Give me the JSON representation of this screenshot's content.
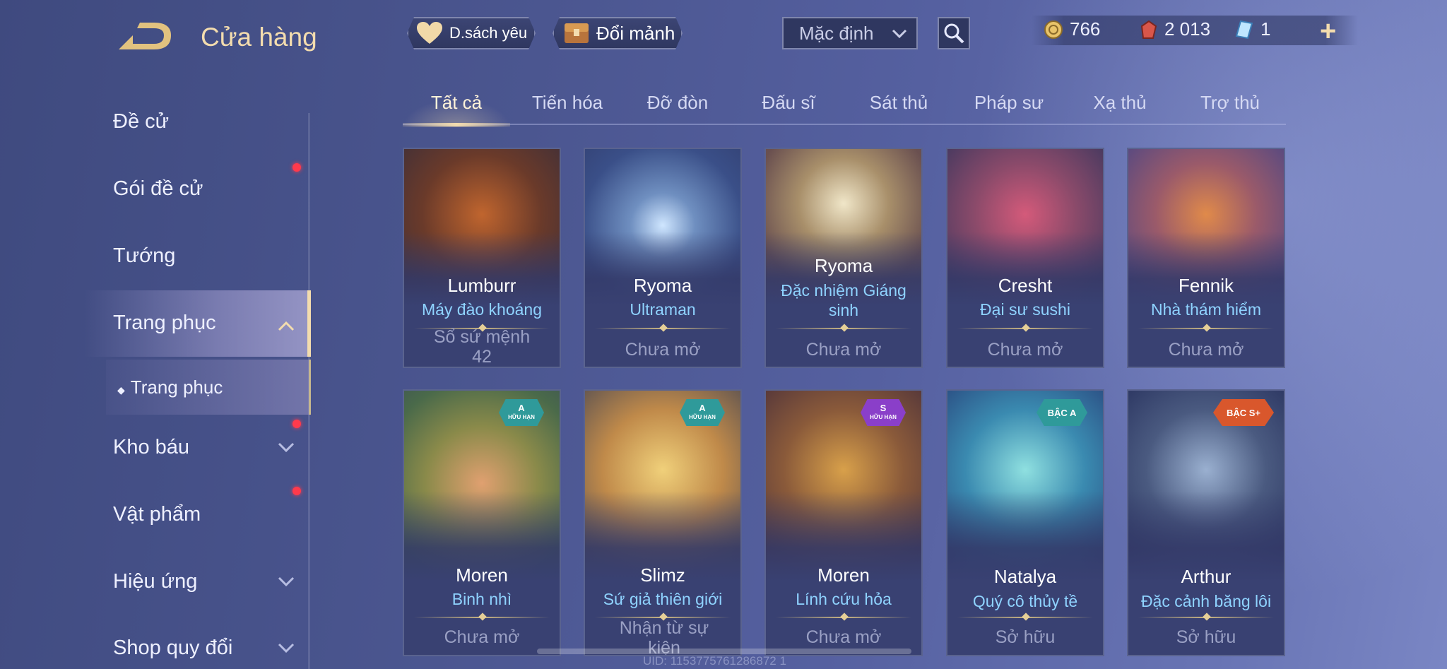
{
  "header": {
    "title": "Cửa hàng",
    "favorites_label": "D.sách yêu",
    "exchange_label": "Đổi mảnh",
    "sort_selected": "Mặc định"
  },
  "currencies": [
    {
      "name": "gold-coin-icon",
      "value": "766"
    },
    {
      "name": "voucher-icon",
      "value": "2 013"
    },
    {
      "name": "diamond-icon",
      "value": "1"
    }
  ],
  "sidebar": {
    "items": [
      {
        "label": "Đề cử"
      },
      {
        "label": "Gói đề cử"
      },
      {
        "label": "Tướng"
      },
      {
        "label": "Trang phục"
      },
      {
        "label": "Trang phục"
      },
      {
        "label": "Kho báu"
      },
      {
        "label": "Vật phẩm"
      },
      {
        "label": "Hiệu ứng"
      },
      {
        "label": "Shop quy đổi"
      }
    ]
  },
  "tabs": [
    "Tất cả",
    "Tiến hóa",
    "Đỡ đòn",
    "Đấu sĩ",
    "Sát thủ",
    "Pháp sư",
    "Xạ thủ",
    "Trợ thủ"
  ],
  "cards": [
    {
      "hero": "Lumburr",
      "skin": "Máy đào khoáng",
      "status": "Sổ sứ mệnh 42"
    },
    {
      "hero": "Ryoma",
      "skin": "Ultraman",
      "status": "Chưa mở"
    },
    {
      "hero": "Ryoma",
      "skin": "Đặc nhiệm Giáng sinh",
      "status": "Chưa mở"
    },
    {
      "hero": "Cresht",
      "skin": "Đại sư sushi",
      "status": "Chưa mở"
    },
    {
      "hero": "Fennik",
      "skin": "Nhà thám hiểm",
      "status": "Chưa mở"
    },
    {
      "hero": "Moren",
      "skin": "Binh nhì",
      "status": "Chưa mở",
      "badge": {
        "tier": "A",
        "note": "HỮU HẠN",
        "color": "#2f9a9a"
      }
    },
    {
      "hero": "Slimz",
      "skin": "Sứ giả thiên giới",
      "status": "Nhận từ sự kiện",
      "badge": {
        "tier": "A",
        "note": "HỮU HẠN",
        "color": "#2f9a9a"
      }
    },
    {
      "hero": "Moren",
      "skin": "Lính cứu hỏa",
      "status": "Chưa mở",
      "badge": {
        "tier": "S",
        "note": "HỮU HẠN",
        "color": "#8a3fc9"
      }
    },
    {
      "hero": "Natalya",
      "skin": "Quý cô thủy tề",
      "status": "Sở hữu",
      "badge": {
        "tier": "BẬC A",
        "note": "",
        "color": "#2f9a9a"
      }
    },
    {
      "hero": "Arthur",
      "skin": "Đặc cảnh băng lôi",
      "status": "Sở hữu",
      "badge": {
        "tier": "BẬC S+",
        "note": "",
        "color": "#d9572c"
      }
    }
  ],
  "footer": {
    "uid": "UID: 1153775761286872 1"
  },
  "colors": {
    "accent_gold": "#f3dcae",
    "skin_name": "#8fd3ff",
    "notification_dot": "#ff3a4c"
  }
}
